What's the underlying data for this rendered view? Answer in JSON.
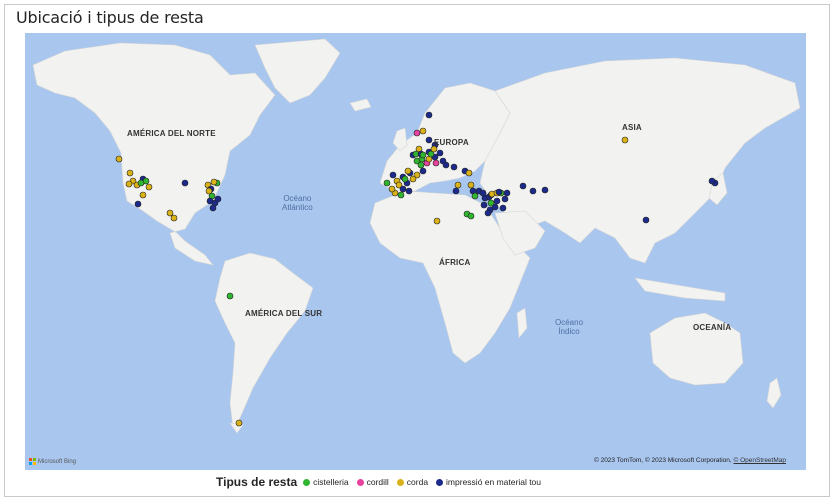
{
  "title": "Ubicació i tipus de resta",
  "map": {
    "region_labels": [
      "AMÉRICA DEL NORTE",
      "EUROPA",
      "ASIA",
      "ÁFRICA",
      "AMÉRICA DEL SUR",
      "OCEANÍA"
    ],
    "ocean_labels": [
      "Océano\nAtlántico",
      "Océano\nÍndico"
    ],
    "bing_label": "Microsoft Bing",
    "copyright": "© 2023 TomTom, © 2023 Microsoft Corporation,",
    "copyright_link": "© OpenStreetMap"
  },
  "legend": {
    "title": "Tipus de resta",
    "items": [
      {
        "label": "cistelleria",
        "color": "#2fb52f"
      },
      {
        "label": "cordill",
        "color": "#e8419e"
      },
      {
        "label": "corda",
        "color": "#d9b21a"
      },
      {
        "label": "impressió en material tou",
        "color": "#1c2a8c"
      }
    ]
  }
}
